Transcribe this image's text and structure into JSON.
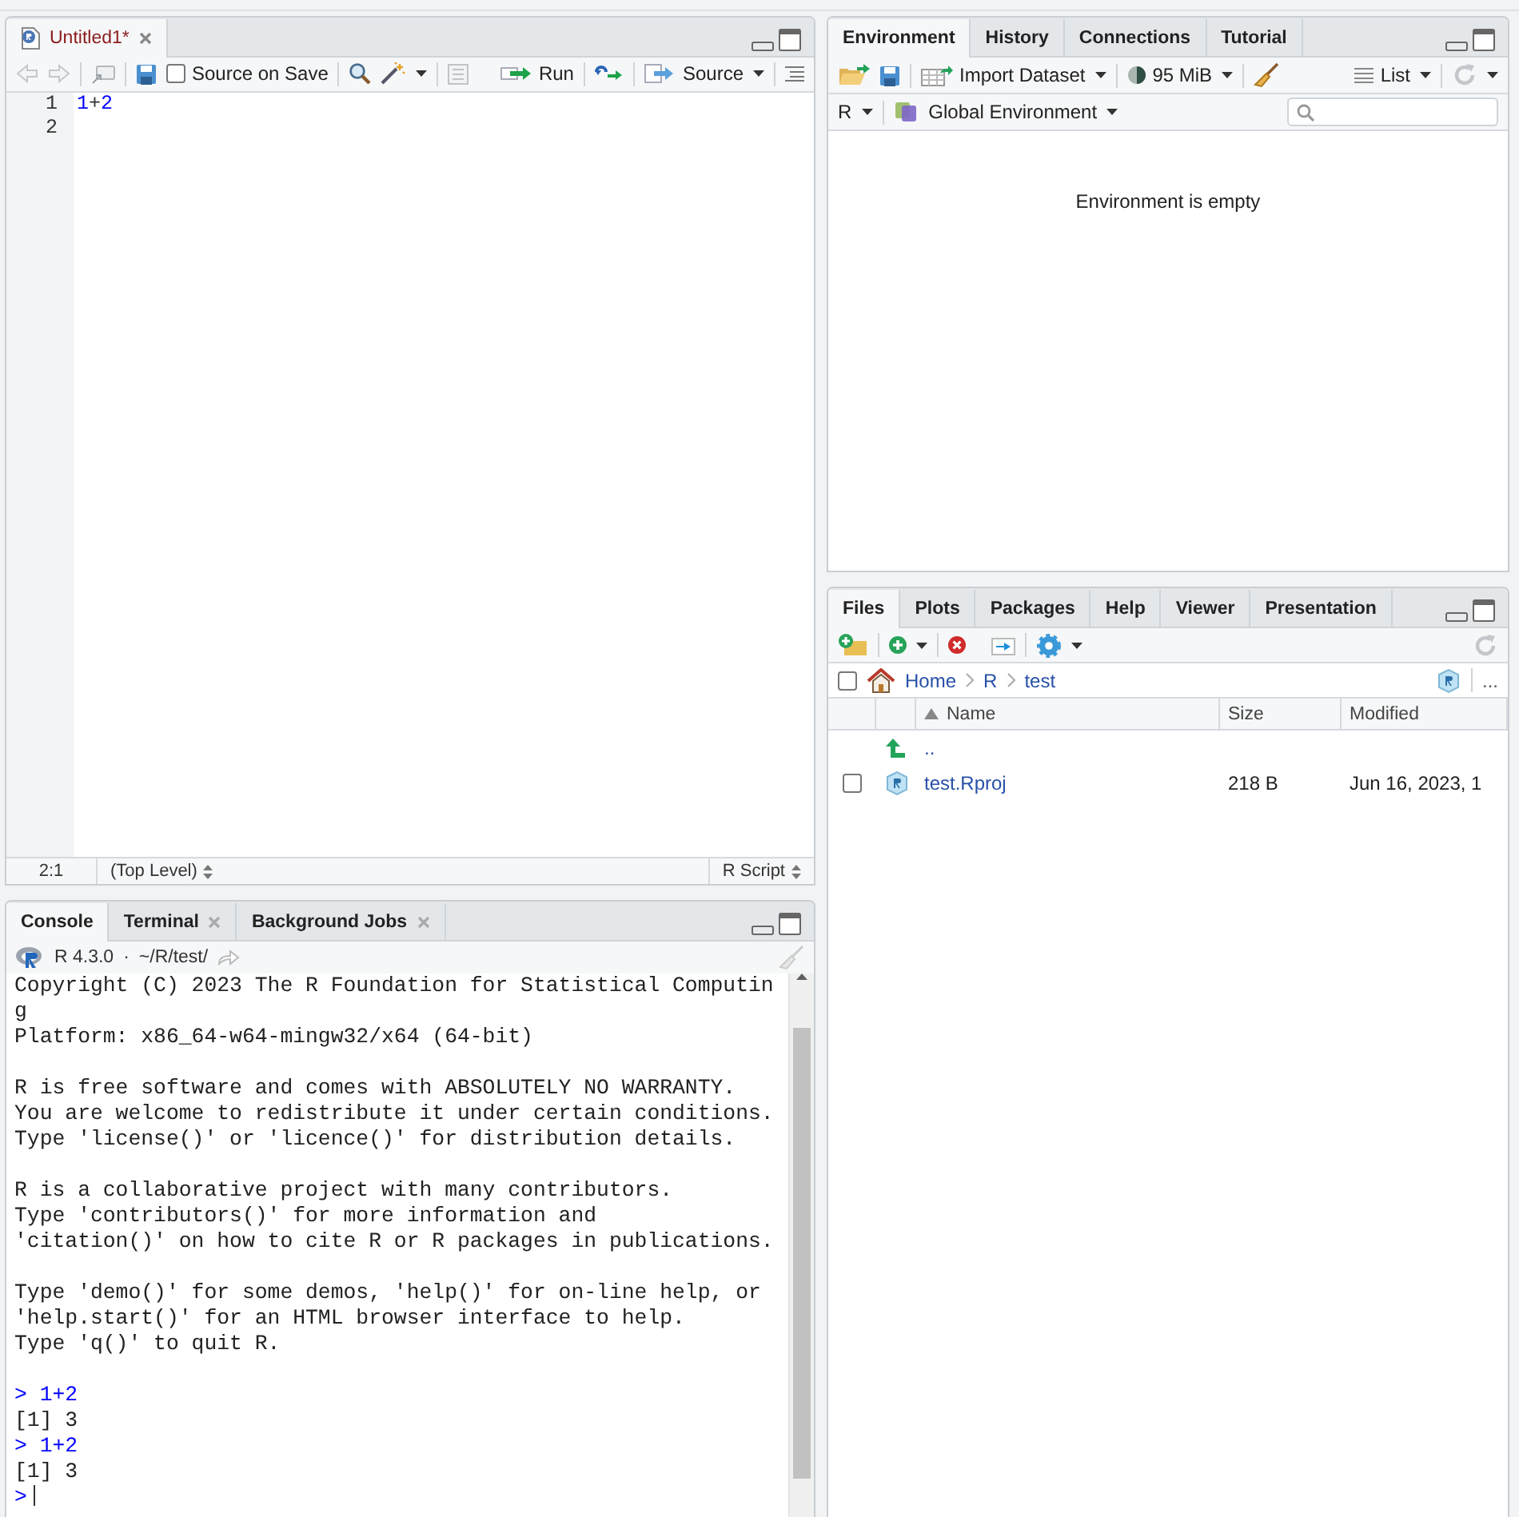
{
  "source_pane": {
    "tabs": [
      {
        "label": "Untitled1*",
        "selected": true
      }
    ],
    "toolbar": {
      "source_on_save": {
        "label": "Source on Save",
        "checked": false
      },
      "run": "Run",
      "source": "Source"
    },
    "lines": [
      {
        "number": "1",
        "tokens": [
          {
            "kind": "number",
            "text": "1"
          },
          {
            "kind": "operator",
            "text": "+"
          },
          {
            "kind": "number",
            "text": "2"
          }
        ]
      },
      {
        "number": "2"
      }
    ],
    "status": {
      "position": "2:1",
      "scope": "(Top Level)",
      "file_type": "R Script"
    }
  },
  "console_pane": {
    "tabs": [
      {
        "label": "Console",
        "selected": true,
        "closable": false
      },
      {
        "label": "Terminal",
        "selected": false,
        "closable": true
      },
      {
        "label": "Background Jobs",
        "selected": false,
        "closable": true
      }
    ],
    "version": "R 4.3.0",
    "separator": "·",
    "path": "~/R/test/",
    "lines": [
      {
        "kind": "output",
        "text": "Copyright (C) 2023 The R Foundation for Statistical Computin"
      },
      {
        "kind": "output",
        "text": "g"
      },
      {
        "kind": "output",
        "text": "Platform: x86_64-w64-mingw32/x64 (64-bit)"
      },
      {
        "kind": "blank"
      },
      {
        "kind": "output",
        "text": "R is free software and comes with ABSOLUTELY NO WARRANTY."
      },
      {
        "kind": "output",
        "text": "You are welcome to redistribute it under certain conditions."
      },
      {
        "kind": "output",
        "text": "Type 'license()' or 'licence()' for distribution details."
      },
      {
        "kind": "blank"
      },
      {
        "kind": "output",
        "text": "R is a collaborative project with many contributors."
      },
      {
        "kind": "output",
        "text": "Type 'contributors()' for more information and"
      },
      {
        "kind": "output",
        "text": "'citation()' on how to cite R or R packages in publications."
      },
      {
        "kind": "blank"
      },
      {
        "kind": "output",
        "text": "Type 'demo()' for some demos, 'help()' for on-line help, or"
      },
      {
        "kind": "output",
        "text": "'help.start()' for an HTML browser interface to help."
      },
      {
        "kind": "output",
        "text": "Type 'q()' to quit R."
      },
      {
        "kind": "blank"
      },
      {
        "kind": "input",
        "text": "> 1+2"
      },
      {
        "kind": "output",
        "text": "[1] 3"
      },
      {
        "kind": "input",
        "text": "> 1+2"
      },
      {
        "kind": "output",
        "text": "[1] 3"
      },
      {
        "kind": "prompt",
        "text": ">"
      }
    ]
  },
  "environment_pane": {
    "tabs": [
      {
        "label": "Environment",
        "selected": true
      },
      {
        "label": "History",
        "selected": false
      },
      {
        "label": "Connections",
        "selected": false
      },
      {
        "label": "Tutorial",
        "selected": false
      }
    ],
    "import": "Import Dataset",
    "memory": "95 MiB",
    "view": "List",
    "language": "R",
    "scope": "Global Environment",
    "message": "Environment is empty"
  },
  "files_pane": {
    "tabs": [
      {
        "label": "Files",
        "selected": true
      },
      {
        "label": "Plots",
        "selected": false
      },
      {
        "label": "Packages",
        "selected": false
      },
      {
        "label": "Help",
        "selected": false
      },
      {
        "label": "Viewer",
        "selected": false
      },
      {
        "label": "Presentation",
        "selected": false
      }
    ],
    "select_all_checked": false,
    "breadcrumb": [
      "Home",
      "R",
      "test"
    ],
    "overflow": "...",
    "columns": [
      {
        "label": "Name",
        "sorted": true
      },
      {
        "label": "Size",
        "sorted": false
      },
      {
        "label": "Modified",
        "sorted": false
      }
    ],
    "rows": [
      {
        "kind": "parent",
        "name": ".."
      },
      {
        "kind": "file",
        "name": "test.Rproj",
        "size": "218 B",
        "modified": "Jun 16, 2023, 1",
        "checked": false
      }
    ]
  }
}
